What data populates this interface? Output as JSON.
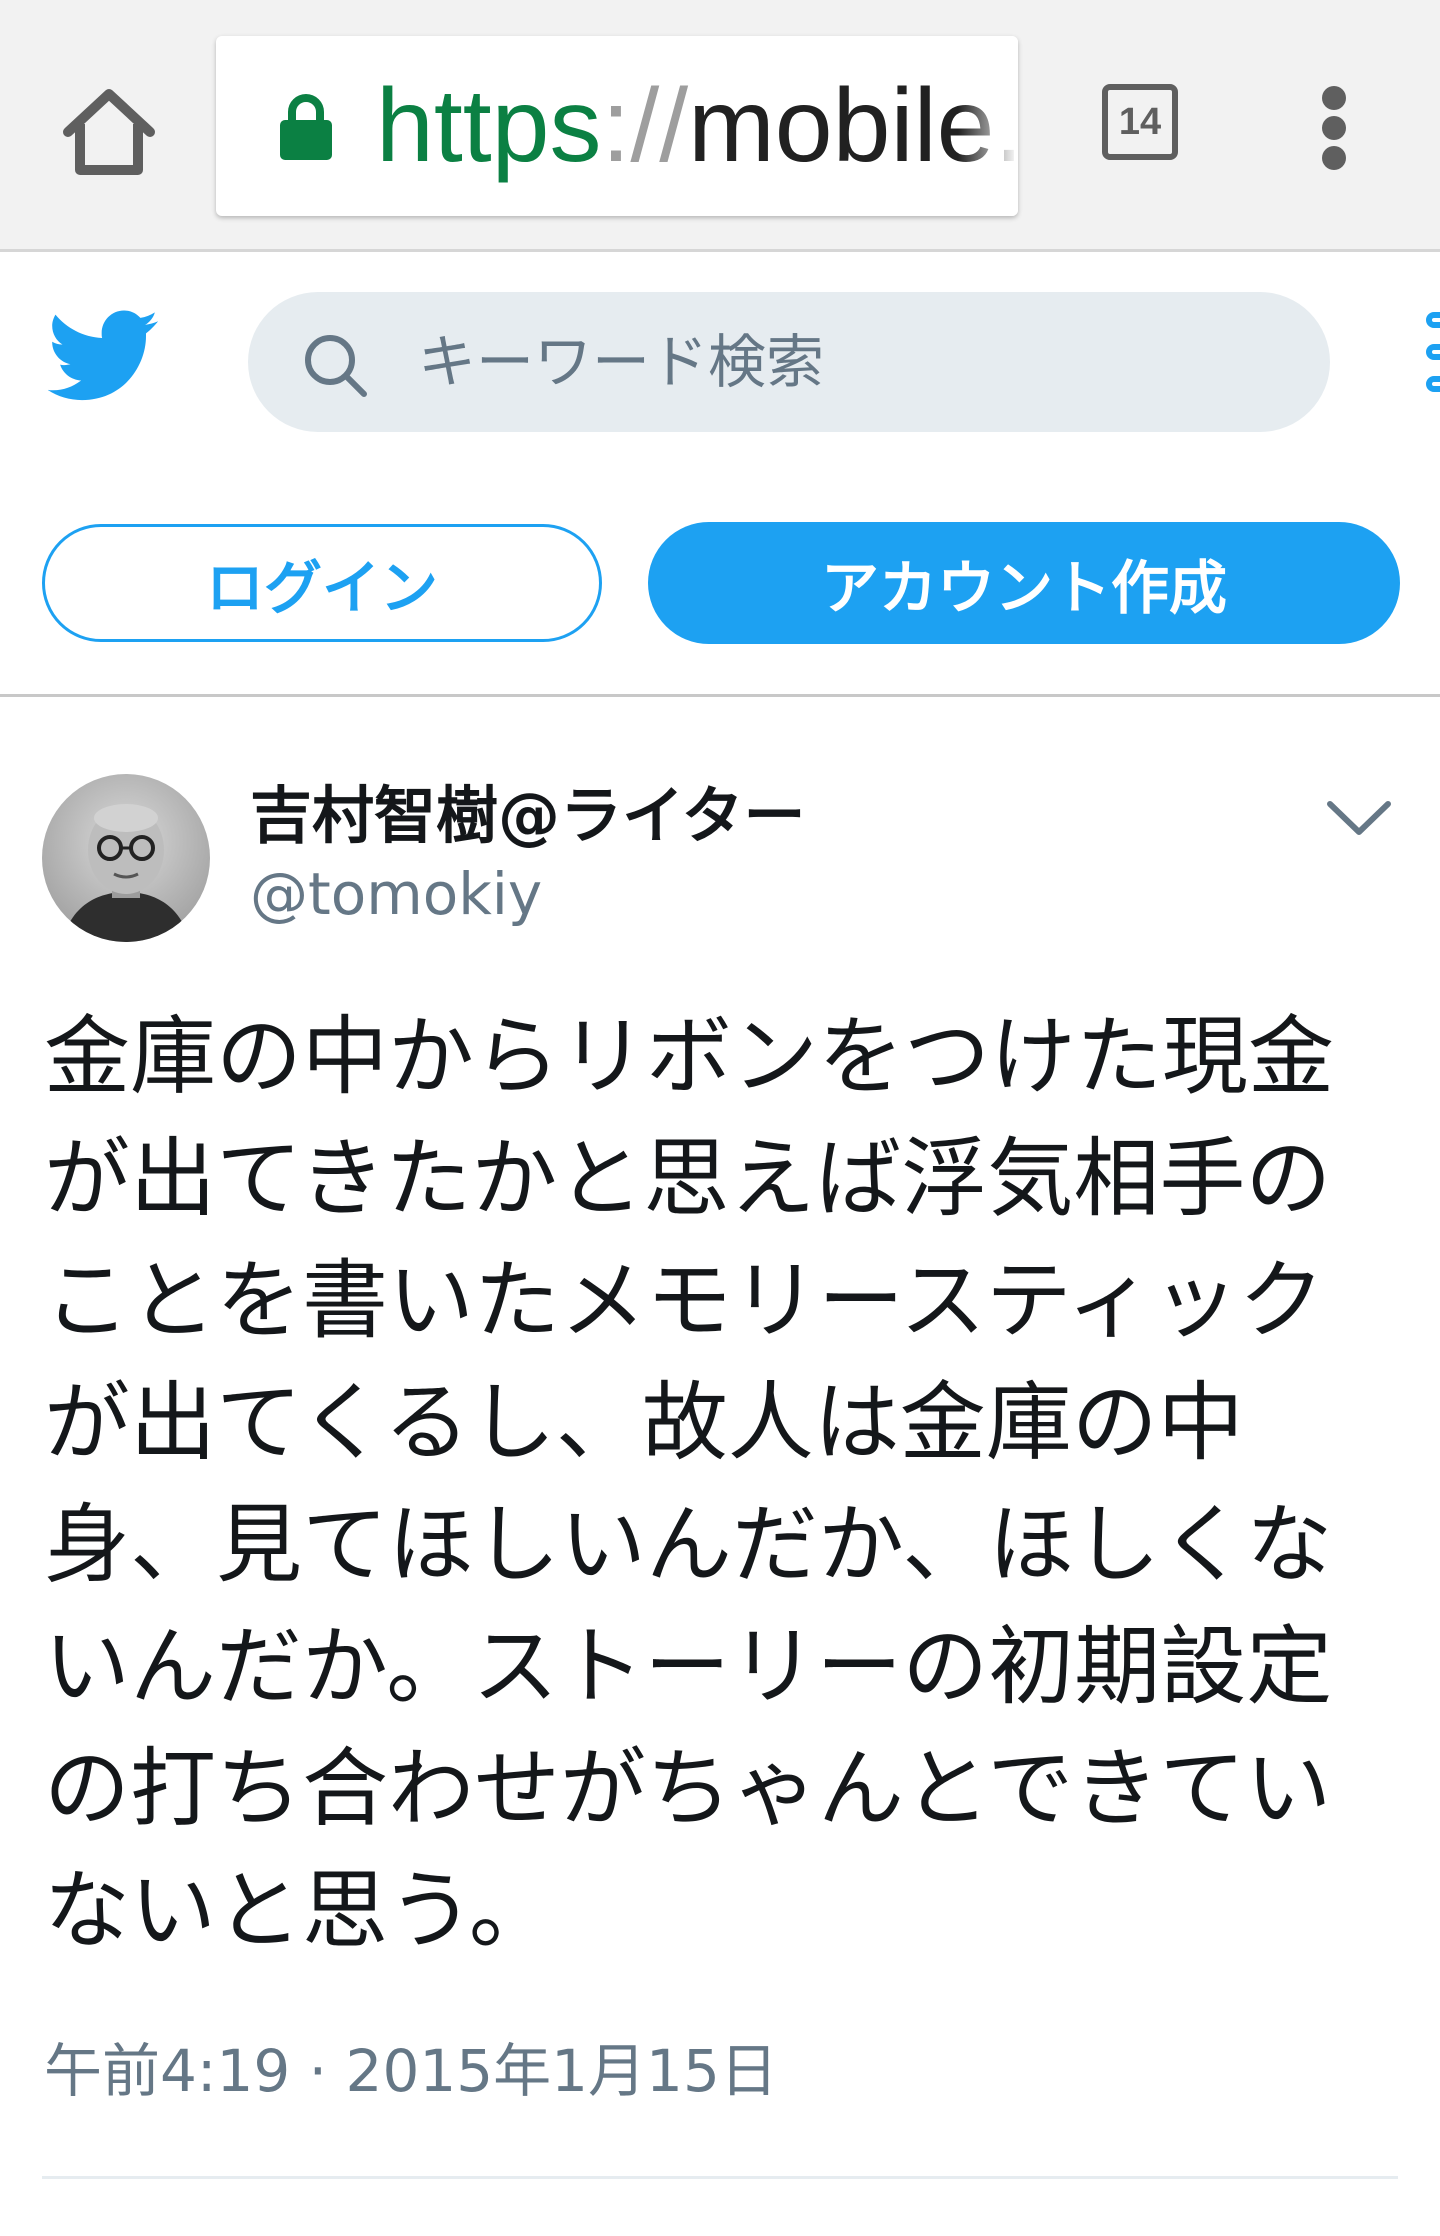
{
  "browser": {
    "url_scheme": "https",
    "url_separator": "://",
    "url_host": "mobile.",
    "tab_count": "14",
    "icons": {
      "home": "home-icon",
      "lock": "lock-icon",
      "menu": "kebab-menu-icon"
    },
    "colors": {
      "secure": "#0b8043"
    }
  },
  "header": {
    "search_placeholder": "キーワード検索",
    "login_label": "ログイン",
    "signup_label": "アカウント作成",
    "icons": {
      "logo": "twitter-bird-icon",
      "search": "search-icon",
      "more": "more-icon"
    },
    "colors": {
      "brand": "#1da1f2"
    }
  },
  "tweet": {
    "author_name": "吉村智樹@ライター",
    "author_handle": "@tomokiy",
    "text": "金庫の中からリボンをつけた現金が出てきたかと思えば浮気相手のことを書いたメモリースティックが出てくるし、故人は金庫の中身、見てほしいんだか、ほしくないんだか。ストーリーの初期設定の打ち合わせがちゃんとできていないと思う。",
    "timestamp": "午前4:19 · 2015年1月15日",
    "icons": {
      "avatar": "avatar",
      "options": "chevron-down-icon"
    }
  }
}
